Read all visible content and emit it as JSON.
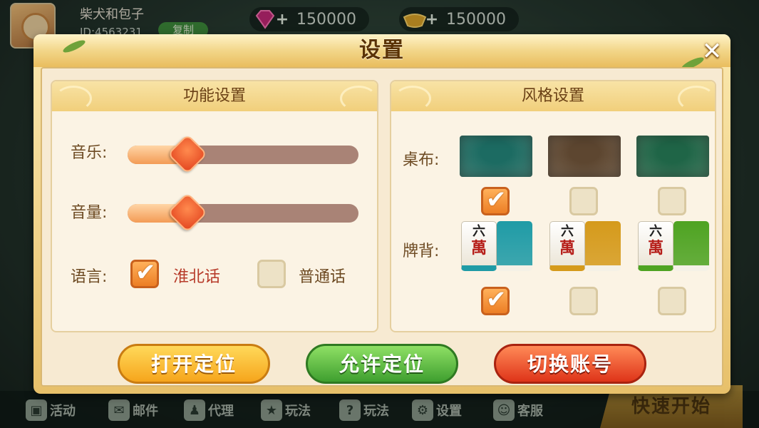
{
  "hud": {
    "player_name": "柴犬和包子",
    "player_id": "ID:4563231",
    "copy_label": "复制",
    "gems": "150000",
    "gold": "150000"
  },
  "bottom_bar": {
    "items": [
      "活动",
      "邮件",
      "代理",
      "玩法",
      "玩法",
      "设置",
      "客服"
    ],
    "quick_start": "快速开始"
  },
  "dialog": {
    "title": "设置",
    "close": "✕"
  },
  "function_panel": {
    "title": "功能设置",
    "music_label": "音乐:",
    "music_value": 0.26,
    "volume_label": "音量:",
    "volume_value": 0.26,
    "language_label": "语言:",
    "languages": [
      {
        "label": "淮北话",
        "checked": true,
        "color": "#b73b2a"
      },
      {
        "label": "普通话",
        "checked": false,
        "color": "#6d4a22"
      }
    ]
  },
  "style_panel": {
    "title": "风格设置",
    "tablecloth_label": "桌布:",
    "tablecloth_colors": [
      "#1c6b62",
      "#5d4630",
      "#1f6547"
    ],
    "tablecloth_selected": 0,
    "tileback_label": "牌背:",
    "tile_face_top": "六",
    "tile_face_main": "萬",
    "tileback_colors": [
      "#1f9ba6",
      "#d59a1b",
      "#4ea322"
    ],
    "tileback_selected": 0
  },
  "buttons": {
    "open_location": "打开定位",
    "allow_location": "允许定位",
    "switch_account": "切换账号"
  },
  "colors": {
    "slider_fill": "#f39b55",
    "slider_track": "#a98376",
    "checked": "#ec7e25"
  }
}
